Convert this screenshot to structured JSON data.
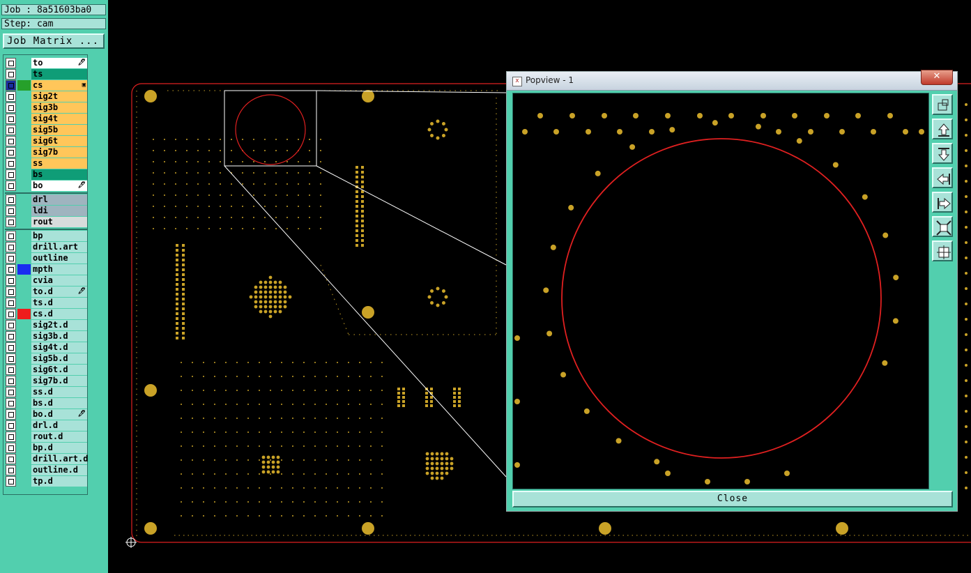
{
  "sidebar": {
    "job_label": "Job : 8a51603ba0",
    "step_label": "Step: cam",
    "job_matrix_button": "Job Matrix ..."
  },
  "layers": [
    {
      "name": "to",
      "bg": "#ffffff",
      "swatch": "",
      "mark": "🖊"
    },
    {
      "name": "ts",
      "bg": "#0f9d77",
      "swatch": "",
      "mark": ""
    },
    {
      "name": "cs",
      "bg": "#ffc65a",
      "swatch": "#26a02a",
      "mark": "▣",
      "active": true
    },
    {
      "name": "sig2t",
      "bg": "#ffc65a",
      "swatch": "",
      "mark": ""
    },
    {
      "name": "sig3b",
      "bg": "#ffc65a",
      "swatch": "",
      "mark": ""
    },
    {
      "name": "sig4t",
      "bg": "#ffc65a",
      "swatch": "",
      "mark": ""
    },
    {
      "name": "sig5b",
      "bg": "#ffc65a",
      "swatch": "",
      "mark": ""
    },
    {
      "name": "sig6t",
      "bg": "#ffc65a",
      "swatch": "",
      "mark": ""
    },
    {
      "name": "sig7b",
      "bg": "#ffc65a",
      "swatch": "",
      "mark": ""
    },
    {
      "name": "ss",
      "bg": "#ffc65a",
      "swatch": "",
      "mark": ""
    },
    {
      "name": "bs",
      "bg": "#0f9d77",
      "swatch": "",
      "mark": ""
    },
    {
      "name": "bo",
      "bg": "#ffffff",
      "swatch": "",
      "mark": "🖊"
    },
    {
      "name": "drl",
      "bg": "#9fb4bf",
      "swatch": "",
      "mark": ""
    },
    {
      "name": "ldi",
      "bg": "#9fb4bf",
      "swatch": "",
      "mark": ""
    },
    {
      "name": "rout",
      "bg": "#d8dcdc",
      "swatch": "",
      "mark": ""
    },
    {
      "name": "bp",
      "bg": "#a8e2d8",
      "swatch": "",
      "mark": ""
    },
    {
      "name": "drill.art",
      "bg": "#a8e2d8",
      "swatch": "",
      "mark": ""
    },
    {
      "name": "outline",
      "bg": "#a8e2d8",
      "swatch": "",
      "mark": ""
    },
    {
      "name": "mpth",
      "bg": "#a8e2d8",
      "swatch": "#1a2cf0",
      "mark": ""
    },
    {
      "name": "cvia",
      "bg": "#a8e2d8",
      "swatch": "",
      "mark": ""
    },
    {
      "name": "to.d",
      "bg": "#a8e2d8",
      "swatch": "",
      "mark": "🖊"
    },
    {
      "name": "ts.d",
      "bg": "#a8e2d8",
      "swatch": "",
      "mark": ""
    },
    {
      "name": "cs.d",
      "bg": "#a8e2d8",
      "swatch": "#ee1c1c",
      "mark": ""
    },
    {
      "name": "sig2t.d",
      "bg": "#a8e2d8",
      "swatch": "",
      "mark": ""
    },
    {
      "name": "sig3b.d",
      "bg": "#a8e2d8",
      "swatch": "",
      "mark": ""
    },
    {
      "name": "sig4t.d",
      "bg": "#a8e2d8",
      "swatch": "",
      "mark": ""
    },
    {
      "name": "sig5b.d",
      "bg": "#a8e2d8",
      "swatch": "",
      "mark": ""
    },
    {
      "name": "sig6t.d",
      "bg": "#a8e2d8",
      "swatch": "",
      "mark": ""
    },
    {
      "name": "sig7b.d",
      "bg": "#a8e2d8",
      "swatch": "",
      "mark": ""
    },
    {
      "name": "ss.d",
      "bg": "#a8e2d8",
      "swatch": "",
      "mark": ""
    },
    {
      "name": "bs.d",
      "bg": "#a8e2d8",
      "swatch": "",
      "mark": ""
    },
    {
      "name": "bo.d",
      "bg": "#a8e2d8",
      "swatch": "",
      "mark": "🖊"
    },
    {
      "name": "drl.d",
      "bg": "#a8e2d8",
      "swatch": "",
      "mark": ""
    },
    {
      "name": "rout.d",
      "bg": "#a8e2d8",
      "swatch": "",
      "mark": ""
    },
    {
      "name": "bp.d",
      "bg": "#a8e2d8",
      "swatch": "",
      "mark": ""
    },
    {
      "name": "drill.art.d",
      "bg": "#a8e2d8",
      "swatch": "",
      "mark": ""
    },
    {
      "name": "outline.d",
      "bg": "#a8e2d8",
      "swatch": "",
      "mark": ""
    },
    {
      "name": "tp.d",
      "bg": "#a8e2d8",
      "swatch": "",
      "mark": ""
    }
  ],
  "popup": {
    "title": "Popview - 1",
    "close_x": "✕",
    "close_button": "Close",
    "tools": [
      "zoom-fit-icon",
      "pan-up-icon",
      "pan-down-icon",
      "pan-left-icon",
      "pan-right-icon",
      "zoom-in-icon",
      "zoom-out-icon"
    ]
  },
  "colors": {
    "panel": "#52cfae",
    "pad": "#c9a227",
    "board_outline": "#e02020",
    "background": "#000000"
  }
}
